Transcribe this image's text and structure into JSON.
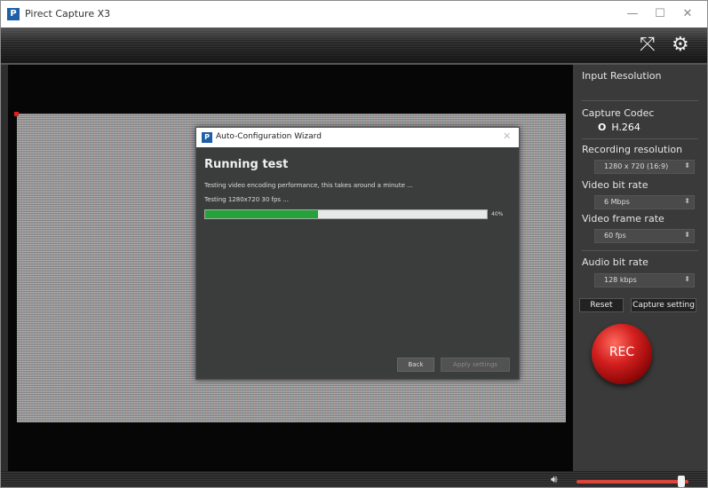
{
  "window": {
    "title": "Pirect Capture X3",
    "app_icon_letter": "P",
    "controls": {
      "minimize": "—",
      "maximize": "☐",
      "close": "✕"
    }
  },
  "toolbar": {
    "icons": [
      "fullscreen-icon",
      "settings-icon"
    ],
    "fullscreen_glyph": "⤧",
    "settings_glyph": "⚙"
  },
  "sidebar": {
    "input_resolution_label": "Input Resolution",
    "capture_codec_label": "Capture Codec",
    "codec_radio_glyph": "O",
    "codec_value": "H.264",
    "recording_resolution_label": "Recording resolution",
    "recording_resolution_value": "1280 x 720 (16:9)",
    "video_bit_rate_label": "Video bit rate",
    "video_bit_rate_value": "6 Mbps",
    "video_frame_rate_label": "Video frame rate",
    "video_frame_rate_value": "60 fps",
    "audio_bit_rate_label": "Audio bit rate",
    "audio_bit_rate_value": "128 kbps",
    "spin_arrow_glyph": "⬍",
    "reset_label": "Reset",
    "capture_setting_label": "Capture setting",
    "rec_label": "REC",
    "rec_color": "#d21f1f"
  },
  "dialog": {
    "title": "Auto-Configuration Wizard",
    "icon_letter": "P",
    "close_glyph": "✕",
    "heading": "Running test",
    "message": "Testing video encoding performance, this takes around a minute ...",
    "status": "Testing 1280x720 30 fps ...",
    "progress_fraction": 0.4,
    "progress_text": "40%",
    "progress_color": "#25a33a",
    "back_label": "Back",
    "apply_label": "Apply settings"
  },
  "playback": {
    "volume_icon": "volume-icon",
    "volume_glyph": "🔊︎",
    "volume_fraction": 0.94,
    "volume_color": "#e0453a"
  }
}
